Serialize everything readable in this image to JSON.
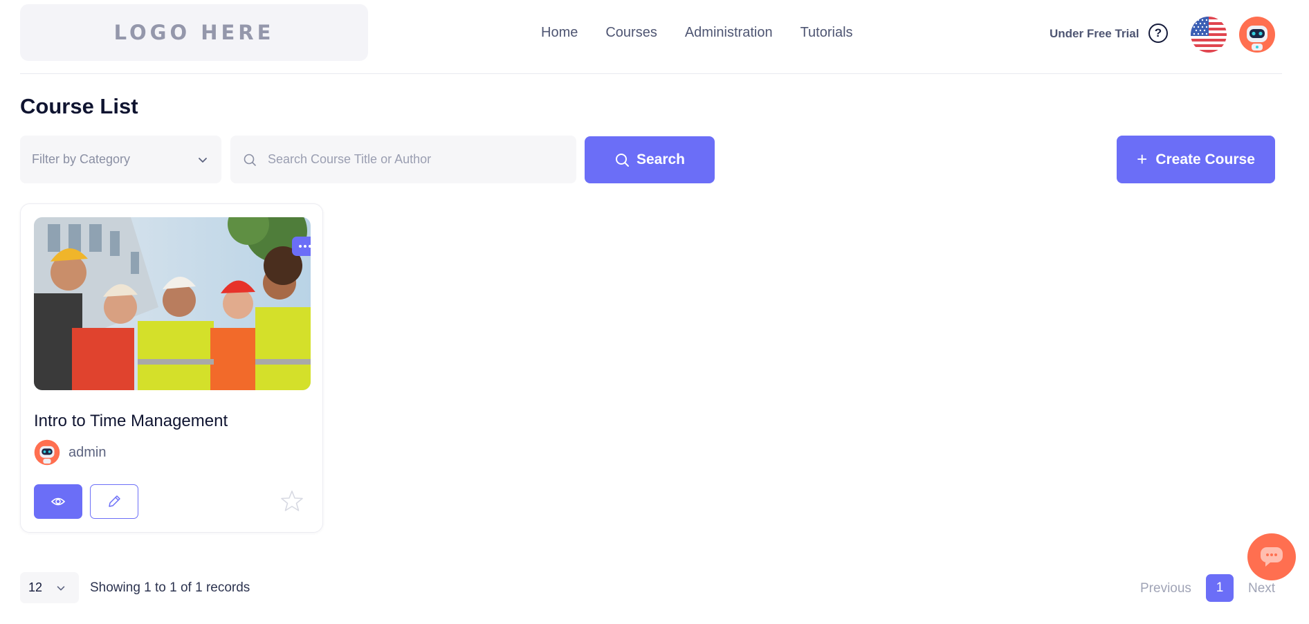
{
  "header": {
    "logo_text": "LOGO HERE",
    "nav": [
      "Home",
      "Courses",
      "Administration",
      "Tutorials"
    ],
    "trial_text": "Under Free Trial",
    "help_glyph": "?",
    "flag_icon": "us-flag-icon",
    "avatar_icon": "robot-avatar-icon"
  },
  "page": {
    "title": "Course List"
  },
  "toolbar": {
    "filter_placeholder": "Filter by Category",
    "search_placeholder": "Search Course Title or Author",
    "search_label": "Search",
    "create_label": "Create Course",
    "create_glyph": "+"
  },
  "courses": [
    {
      "title": "Intro to Time Management",
      "author": "admin",
      "image": "construction-workers-photo",
      "starred": false
    }
  ],
  "pagination": {
    "per_page": "12",
    "summary": "Showing 1 to 1 of 1 records",
    "previous": "Previous",
    "current_page": "1",
    "next": "Next"
  },
  "colors": {
    "accent": "#6b6ef7",
    "chat": "#ff6f50",
    "text": "#141a3a"
  }
}
